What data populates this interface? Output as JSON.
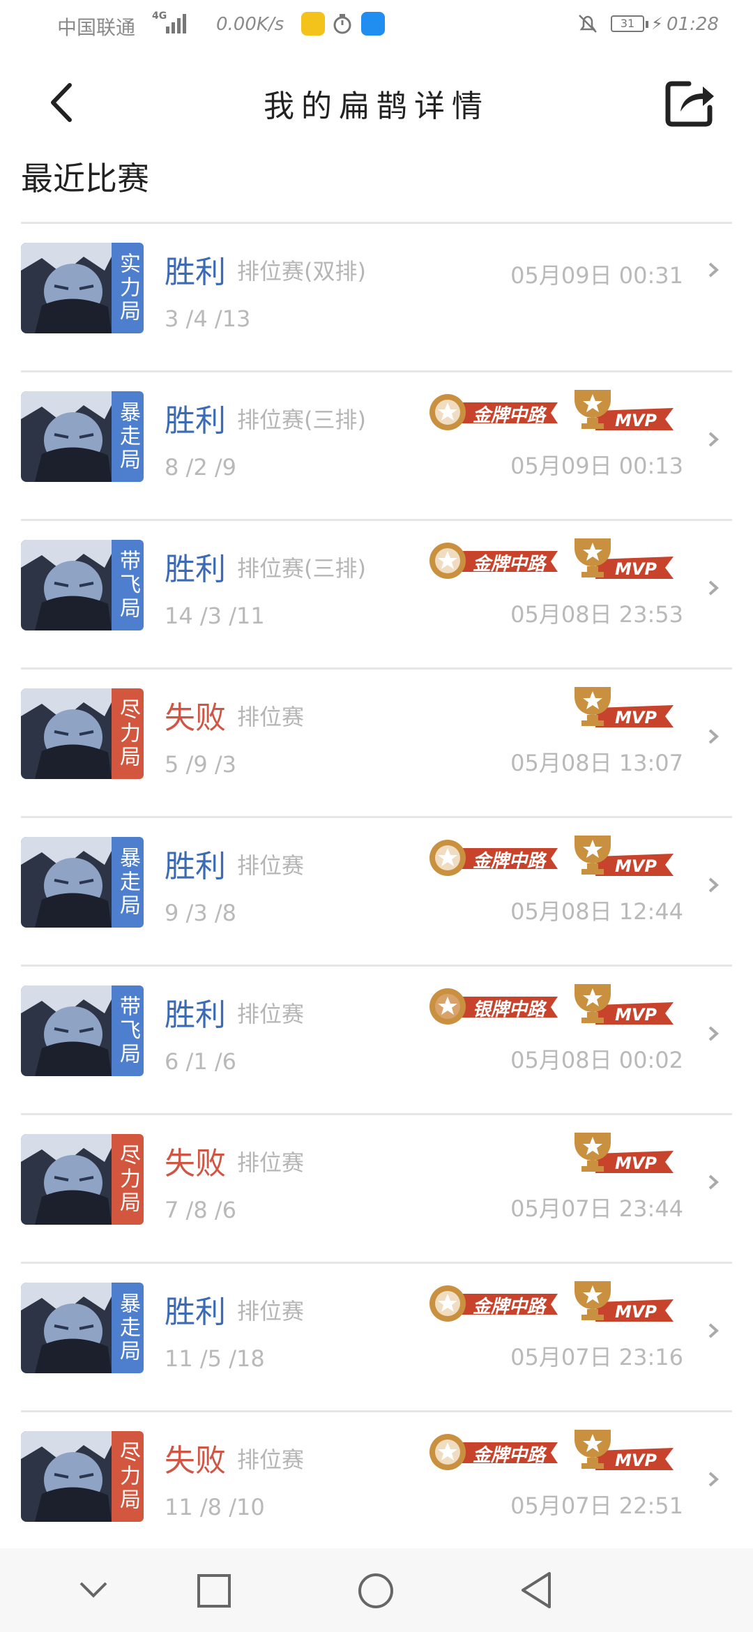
{
  "status_bar": {
    "carrier": "中国联通",
    "network": "4G",
    "speed": "0.00K/s",
    "battery": "31",
    "time": "01:28"
  },
  "header": {
    "title": "我的扁鹊详情",
    "back_icon": "chevron-left-icon",
    "share_icon": "share-icon"
  },
  "section_title": "最近比赛",
  "colors": {
    "win": "#3c6bb5",
    "lose": "#cf5645",
    "tag_blue": "#4e7fce",
    "tag_red": "#d2573e",
    "badge_ribbon": "#c8432c",
    "badge_gold": "#c9903f"
  },
  "matches": [
    {
      "tag": "实力局",
      "tag_color": "blue",
      "result": "胜利",
      "result_type": "win",
      "mode": "排位赛(双排)",
      "kda": "3 /4 /13",
      "time": "05月09日 00:31",
      "badge": "",
      "mvp": false
    },
    {
      "tag": "暴走局",
      "tag_color": "blue",
      "result": "胜利",
      "result_type": "win",
      "mode": "排位赛(三排)",
      "kda": "8 /2 /9",
      "time": "05月09日 00:13",
      "badge": "金牌中路",
      "mvp": true
    },
    {
      "tag": "带飞局",
      "tag_color": "blue",
      "result": "胜利",
      "result_type": "win",
      "mode": "排位赛(三排)",
      "kda": "14 /3 /11",
      "time": "05月08日 23:53",
      "badge": "金牌中路",
      "mvp": true
    },
    {
      "tag": "尽力局",
      "tag_color": "red",
      "result": "失败",
      "result_type": "lose",
      "mode": "排位赛",
      "kda": "5 /9 /3",
      "time": "05月08日 13:07",
      "badge": "",
      "mvp": true
    },
    {
      "tag": "暴走局",
      "tag_color": "blue",
      "result": "胜利",
      "result_type": "win",
      "mode": "排位赛",
      "kda": "9 /3 /8",
      "time": "05月08日 12:44",
      "badge": "金牌中路",
      "mvp": true
    },
    {
      "tag": "带飞局",
      "tag_color": "blue",
      "result": "胜利",
      "result_type": "win",
      "mode": "排位赛",
      "kda": "6 /1 /6",
      "time": "05月08日 00:02",
      "badge": "银牌中路",
      "mvp": true
    },
    {
      "tag": "尽力局",
      "tag_color": "red",
      "result": "失败",
      "result_type": "lose",
      "mode": "排位赛",
      "kda": "7 /8 /6",
      "time": "05月07日 23:44",
      "badge": "",
      "mvp": true
    },
    {
      "tag": "暴走局",
      "tag_color": "blue",
      "result": "胜利",
      "result_type": "win",
      "mode": "排位赛",
      "kda": "11 /5 /18",
      "time": "05月07日 23:16",
      "badge": "金牌中路",
      "mvp": true
    },
    {
      "tag": "尽力局",
      "tag_color": "red",
      "result": "失败",
      "result_type": "lose",
      "mode": "排位赛",
      "kda": "11 /8 /10",
      "time": "05月07日 22:51",
      "badge": "金牌中路",
      "mvp": true
    }
  ],
  "mvp_label": "MVP",
  "nav_bar": {
    "items": [
      "chevron-down-icon",
      "square-icon",
      "circle-icon",
      "triangle-back-icon"
    ]
  }
}
